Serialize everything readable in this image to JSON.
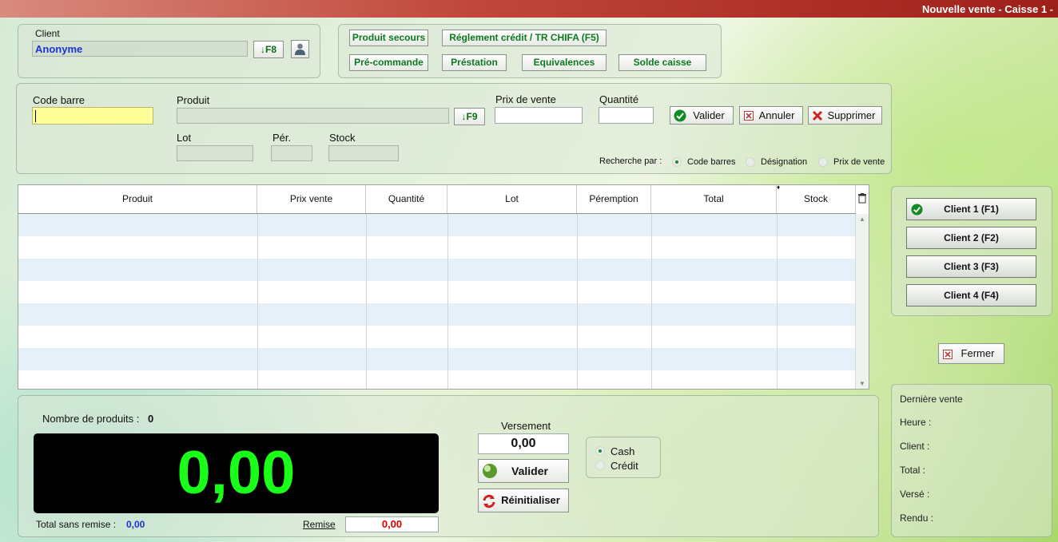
{
  "window": {
    "title": "Nouvelle vente - Caisse 1 -"
  },
  "client": {
    "label": "Client",
    "value": "Anonyme",
    "f8_label": "↓F8",
    "user_icon": "user-icon"
  },
  "actions": {
    "produit_secours": "Produit secours",
    "reglement_credit": "Réglement crédit / TR CHIFA (F5)",
    "pre_commande": "Pré-commande",
    "prestation": "Préstation",
    "equivalences": "Equivalences",
    "solde_caisse": "Solde caisse"
  },
  "entry": {
    "code_barre_label": "Code barre",
    "produit_label": "Produit",
    "f9_label": "↓F9",
    "prix_label": "Prix de vente",
    "quantite_label": "Quantité",
    "lot_label": "Lot",
    "per_label": "Pér.",
    "stock_label": "Stock",
    "valider": "Valider",
    "annuler": "Annuler",
    "supprimer": "Supprimer",
    "recherche_label": "Recherche par :",
    "recherche_options": [
      "Code barres",
      "Désignation",
      "Prix de vente"
    ],
    "recherche_selected": "Code barres"
  },
  "table": {
    "columns": [
      "Produit",
      "Prix vente",
      "Quantité",
      "Lot",
      "Péremption",
      "Total",
      "Stock"
    ],
    "rows": []
  },
  "clients": [
    "Client 1 (F1)",
    "Client 2 (F2)",
    "Client 3 (F3)",
    "Client 4 (F4)"
  ],
  "fermer": "Fermer",
  "summary": {
    "nombre_label": "Nombre de produits :",
    "nombre_value": "0",
    "total_display": "0,00",
    "total_sans_remise_label": "Total sans remise :",
    "total_sans_remise_value": "0,00",
    "remise_label": "Remise",
    "remise_value": "0,00"
  },
  "payment": {
    "versement_label": "Versement",
    "versement_value": "0,00",
    "valider": "Valider",
    "reinitialiser": "Réinitialiser",
    "modes": [
      "Cash",
      "Crédit"
    ],
    "selected_mode": "Cash"
  },
  "derniere_vente": {
    "title": "Dernière vente",
    "heure": "Heure :",
    "client": "Client :",
    "total": "Total :",
    "verse": "Versé :",
    "rendu": "Rendu :"
  },
  "colors": {
    "display_bg": "#000000",
    "display_fg": "#19ff19",
    "client_text": "#1b33d0",
    "remise_text": "#e00000"
  }
}
